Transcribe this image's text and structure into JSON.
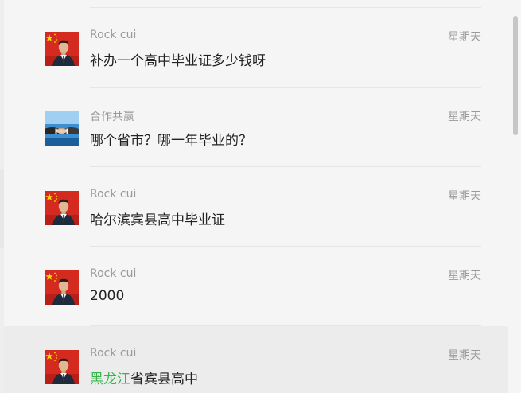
{
  "messages": [
    {
      "avatar": "person-flag-avatar",
      "sender": "Rock cui",
      "time": "星期天",
      "preview": "补办一个高中毕业证多少钱呀"
    },
    {
      "avatar": "handshake-avatar",
      "sender": "合作共赢",
      "time": "星期天",
      "preview": "哪个省市？哪一年毕业的？"
    },
    {
      "avatar": "person-flag-avatar",
      "sender": "Rock cui",
      "time": "星期天",
      "preview": "哈尔滨宾县高中毕业证"
    },
    {
      "avatar": "person-flag-avatar",
      "sender": "Rock cui",
      "time": "星期天",
      "preview": "2000"
    },
    {
      "avatar": "person-flag-avatar",
      "sender": "Rock cui",
      "time": "星期天",
      "preview_highlight": "黑龙江",
      "preview_rest": "省宾县高中",
      "selected": true
    }
  ],
  "colors": {
    "highlight": "#37b24d",
    "sender": "#999999",
    "time": "#999999",
    "preview": "#222222"
  }
}
